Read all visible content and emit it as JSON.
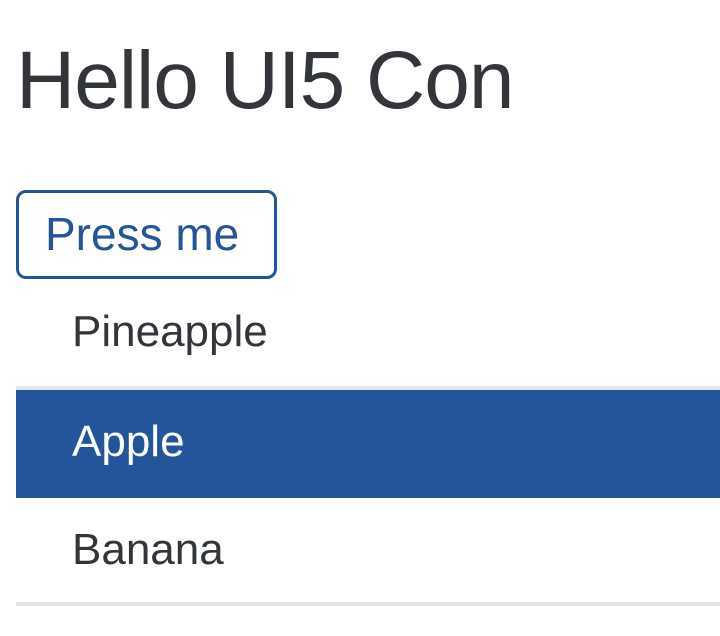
{
  "header": {
    "title": "Hello UI5 Con"
  },
  "actions": {
    "press_label": "Press me"
  },
  "list": {
    "items": [
      {
        "label": "Pineapple",
        "selected": false
      },
      {
        "label": "Apple",
        "selected": true
      },
      {
        "label": "Banana",
        "selected": false
      }
    ]
  },
  "colors": {
    "accent": "#24549a",
    "text": "#32363a",
    "divider": "#e5e5e5",
    "background": "#ffffff"
  }
}
